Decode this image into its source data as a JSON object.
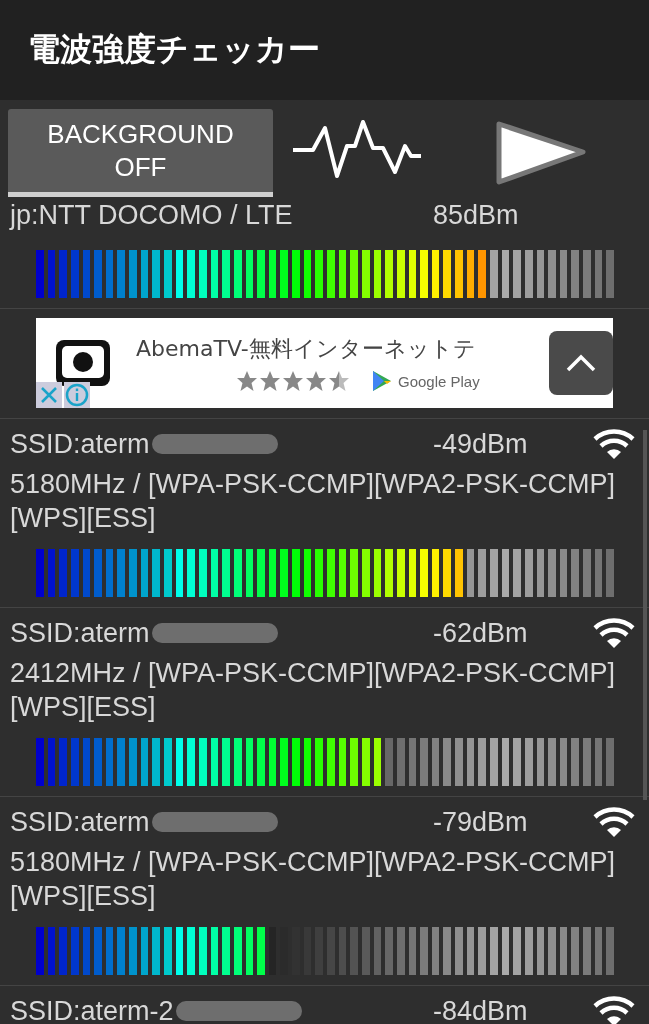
{
  "app_bar": {
    "title": "電波強度チェッカー"
  },
  "toolbar": {
    "background_button": "BACKGROUND\nOFF"
  },
  "ad": {
    "title": "AbemaTV-無料インターネットテ",
    "stars": 4.5,
    "store": "Google Play"
  },
  "networks": [
    {
      "kind": "cell",
      "name": "jp:NTT DOCOMO / LTE",
      "signal": "85dBm",
      "level": 0.78
    },
    {
      "kind": "wifi",
      "name": "SSID:aterm",
      "redacted": true,
      "signal": "-49dBm",
      "details": "5180MHz / [WPA-PSK-CCMP][WPA2-PSK-CCMP][WPS][ESS]",
      "level": 0.74
    },
    {
      "kind": "wifi",
      "name": "SSID:aterm",
      "redacted": true,
      "signal": "-62dBm",
      "details": "2412MHz / [WPA-PSK-CCMP][WPA2-PSK-CCMP][WPS][ESS]",
      "level": 0.6
    },
    {
      "kind": "wifi",
      "name": "SSID:aterm",
      "redacted": true,
      "signal": "-79dBm",
      "details": "5180MHz / [WPA-PSK-CCMP][WPA2-PSK-CCMP][WPS][ESS]",
      "level": 0.4
    },
    {
      "kind": "wifi",
      "name": "SSID:aterm-2",
      "redacted": true,
      "signal": "-84dBm"
    }
  ]
}
